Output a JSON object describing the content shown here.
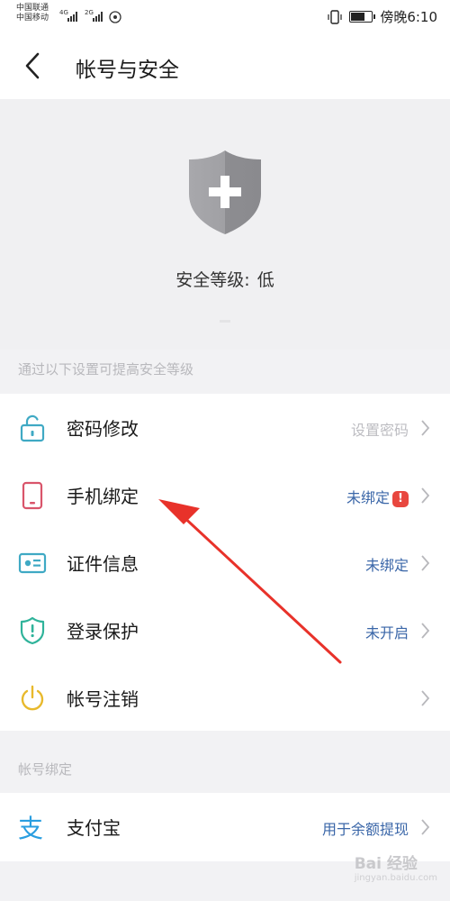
{
  "status_bar": {
    "carrier_1": "中国联通",
    "carrier_2": "中国移动",
    "net_1": "4G",
    "net_2": "2G",
    "time": "傍晚6:10"
  },
  "header": {
    "title": "帐号与安全"
  },
  "security": {
    "level_label": "安全等级:",
    "level_value": "低"
  },
  "section_1": {
    "hint": "通过以下设置可提高安全等级"
  },
  "rows": [
    {
      "label": "密码修改",
      "value": "设置密码",
      "icon": "lock-icon",
      "value_color": "#bdbdc2"
    },
    {
      "label": "手机绑定",
      "value": "未绑定",
      "icon": "phone-icon",
      "value_color": "#3a66a8",
      "badge": "!"
    },
    {
      "label": "证件信息",
      "value": "未绑定",
      "icon": "id-card-icon",
      "value_color": "#3a66a8"
    },
    {
      "label": "登录保护",
      "value": "未开启",
      "icon": "shield-icon",
      "value_color": "#3a66a8"
    },
    {
      "label": "帐号注销",
      "value": "",
      "icon": "power-icon"
    }
  ],
  "section_2": {
    "title": "帐号绑定"
  },
  "bindings": [
    {
      "label": "支付宝",
      "value": "用于余额提现",
      "icon": "alipay-icon"
    }
  ],
  "watermark": {
    "brand": "Bai 经验",
    "url": "jingyan.baidu.com"
  },
  "colors": {
    "accent_blue": "#3a66a8",
    "alert_red": "#e8473f",
    "arrow_red": "#e8322a",
    "shield_gray": "#9a9a9e"
  }
}
